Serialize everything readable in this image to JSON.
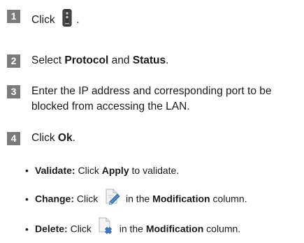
{
  "steps": [
    {
      "num": "1",
      "click": "Click",
      "period": "."
    },
    {
      "num": "2",
      "pre": "Select ",
      "protocol": "Protocol",
      "and": " and ",
      "status": "Status",
      "post": "."
    },
    {
      "num": "3",
      "text": "Enter the IP address and corresponding port to be blocked from accessing the LAN."
    },
    {
      "num": "4",
      "click": "Click ",
      "ok": "Ok",
      "post": "."
    }
  ],
  "bullets": {
    "validate": {
      "label": "Validate:",
      "pre": " Click ",
      "bold": "Apply",
      "post": " to validate."
    },
    "change": {
      "label": "Change:",
      "pre": " Click ",
      "mid": " in the ",
      "bold": "Modification",
      "post": " column."
    },
    "delete": {
      "label": "Delete:",
      "pre": " Click ",
      "mid": " in the ",
      "bold": "Modification",
      "post": " column."
    }
  },
  "icons": [
    "device-icon",
    "edit-icon",
    "delete-icon"
  ]
}
